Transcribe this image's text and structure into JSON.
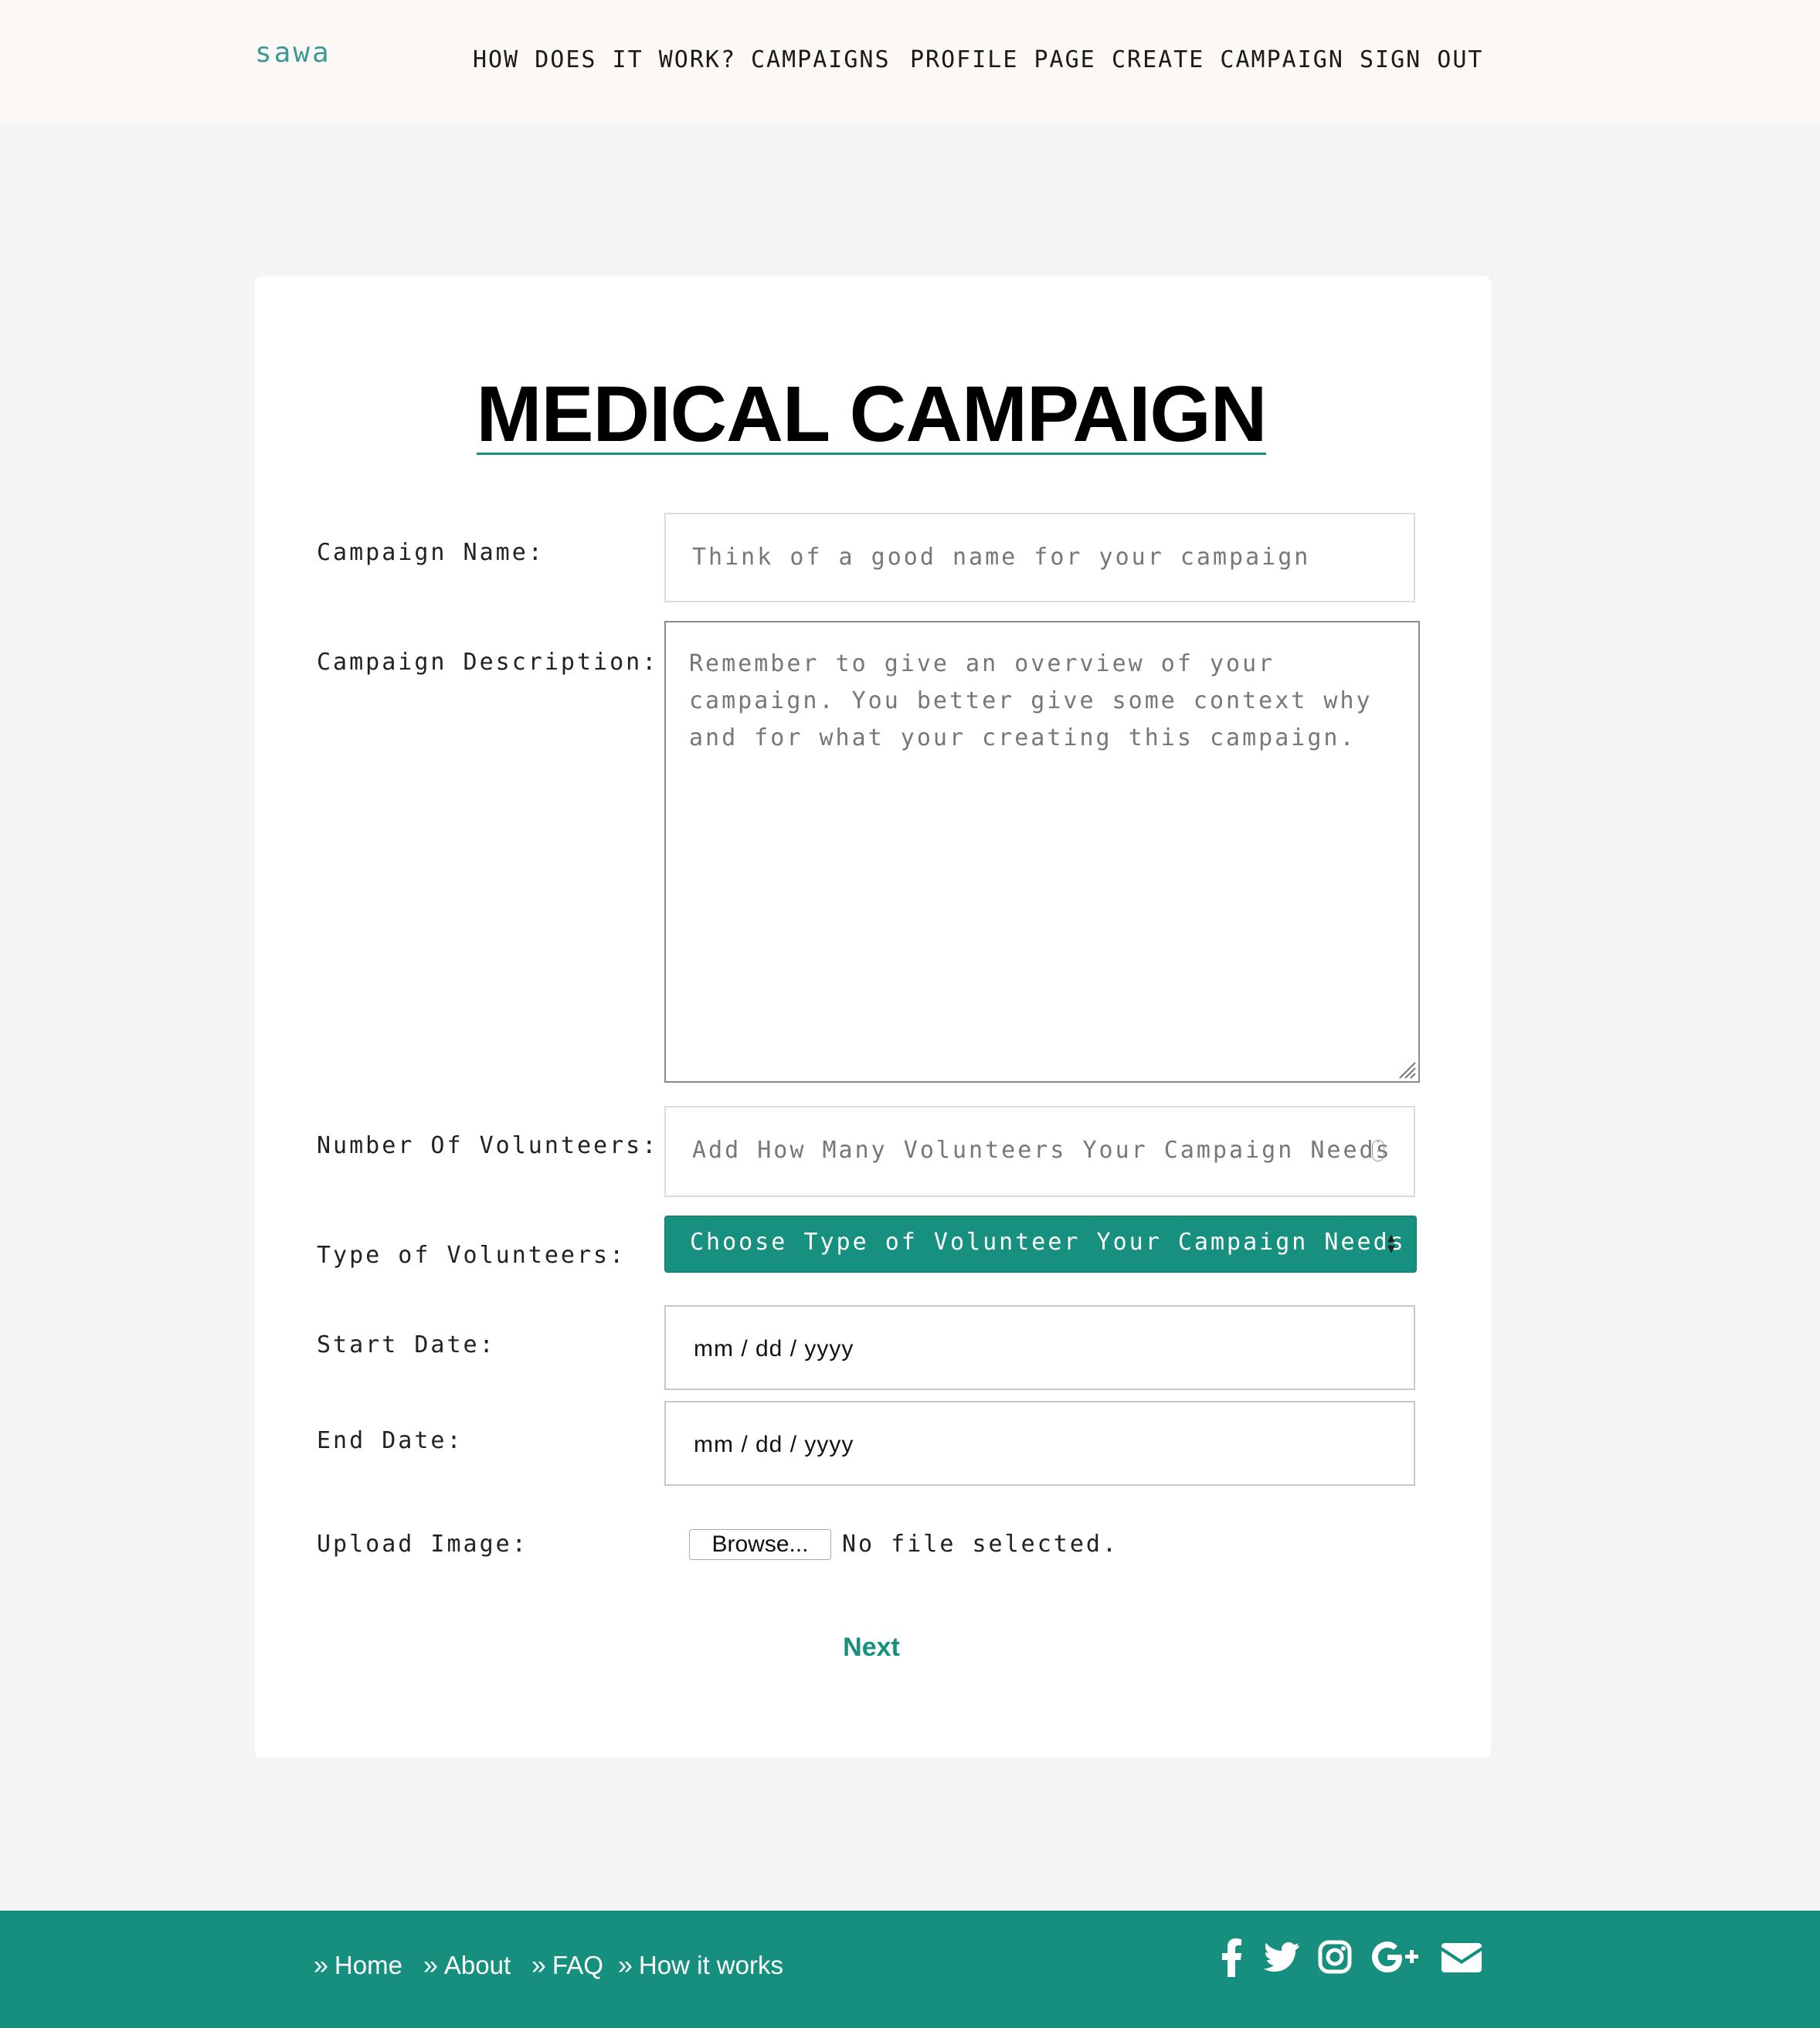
{
  "header": {
    "logo": "sawa",
    "nav": [
      "HOW DOES IT WORK?",
      "CAMPAIGNS",
      "PROFILE PAGE",
      "CREATE CAMPAIGN",
      "SIGN OUT"
    ]
  },
  "form": {
    "title": "MEDICAL CAMPAIGN",
    "campaign_name": {
      "label": "Campaign Name:",
      "placeholder": "Think of a good name for your campaign"
    },
    "campaign_description": {
      "label": "Campaign Description:",
      "placeholder": "Remember to give an overview of your campaign. You better give some context why and for what your creating this campaign."
    },
    "num_volunteers": {
      "label": "Number Of Volunteers:",
      "placeholder": "Add How Many Volunteers Your Campaign Needs"
    },
    "type_volunteers": {
      "label": "Type of Volunteers:",
      "selected": "Choose Type of Volunteer Your Campaign Needs"
    },
    "start_date": {
      "label": "Start Date:",
      "placeholder": "mm / dd / yyyy"
    },
    "end_date": {
      "label": "End Date:",
      "placeholder": "mm / dd / yyyy"
    },
    "upload_image": {
      "label": "Upload Image:",
      "button": "Browse...",
      "status": "No file selected."
    },
    "next": "Next"
  },
  "footer": {
    "links": [
      "Home",
      "About",
      "FAQ",
      "How it works"
    ],
    "social_icons": [
      "facebook-icon",
      "twitter-icon",
      "instagram-icon",
      "google-plus-icon",
      "envelope-icon"
    ]
  },
  "colors": {
    "accent": "#17907f",
    "logo": "#3b9a95",
    "page_bg": "#f4f4f4",
    "header_bg": "#fbf8f5"
  }
}
